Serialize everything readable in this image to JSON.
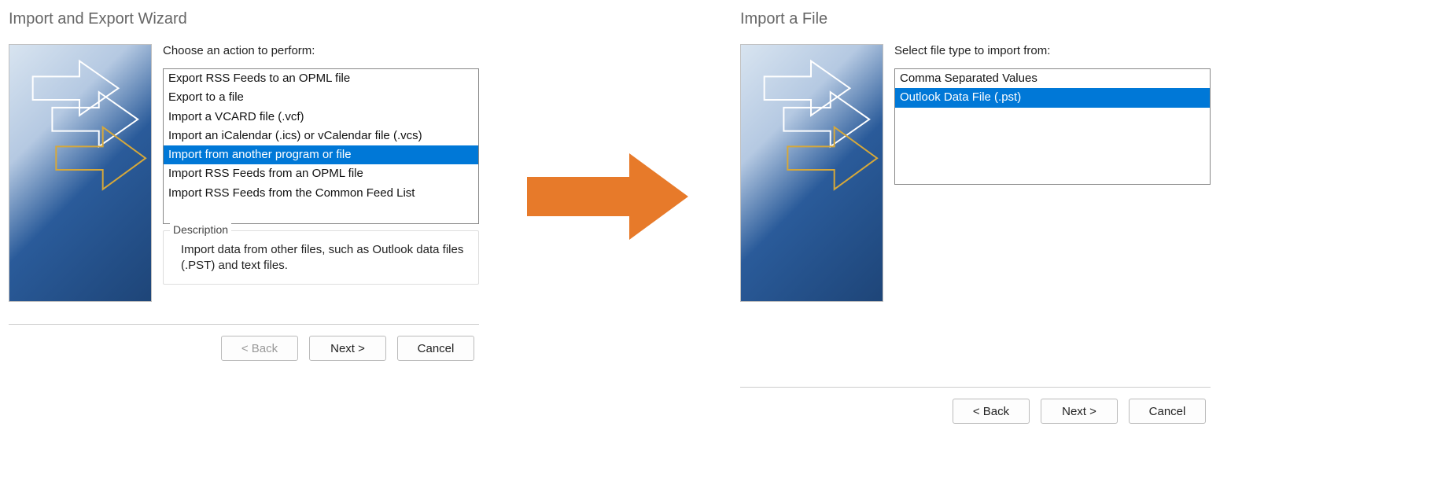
{
  "left": {
    "title": "Import and Export Wizard",
    "prompt": "Choose an action to perform:",
    "actions": [
      {
        "label": "Export RSS Feeds to an OPML file",
        "selected": false
      },
      {
        "label": "Export to a file",
        "selected": false
      },
      {
        "label": "Import a VCARD file (.vcf)",
        "selected": false
      },
      {
        "label": "Import an iCalendar (.ics) or vCalendar file (.vcs)",
        "selected": false
      },
      {
        "label": "Import from another program or file",
        "selected": true
      },
      {
        "label": "Import RSS Feeds from an OPML file",
        "selected": false
      },
      {
        "label": "Import RSS Feeds from the Common Feed List",
        "selected": false
      }
    ],
    "description_label": "Description",
    "description_text": "Import data from other files, such as Outlook data files (.PST) and text files.",
    "buttons": {
      "back": "< Back",
      "next": "Next >",
      "cancel": "Cancel"
    },
    "back_enabled": false
  },
  "right": {
    "title": "Import a File",
    "prompt": "Select file type to import from:",
    "types": [
      {
        "label": "Comma Separated Values",
        "selected": false
      },
      {
        "label": "Outlook Data File (.pst)",
        "selected": true
      }
    ],
    "buttons": {
      "back": "< Back",
      "next": "Next >",
      "cancel": "Cancel"
    },
    "back_enabled": true
  },
  "arrow_color": "#e77a2a"
}
